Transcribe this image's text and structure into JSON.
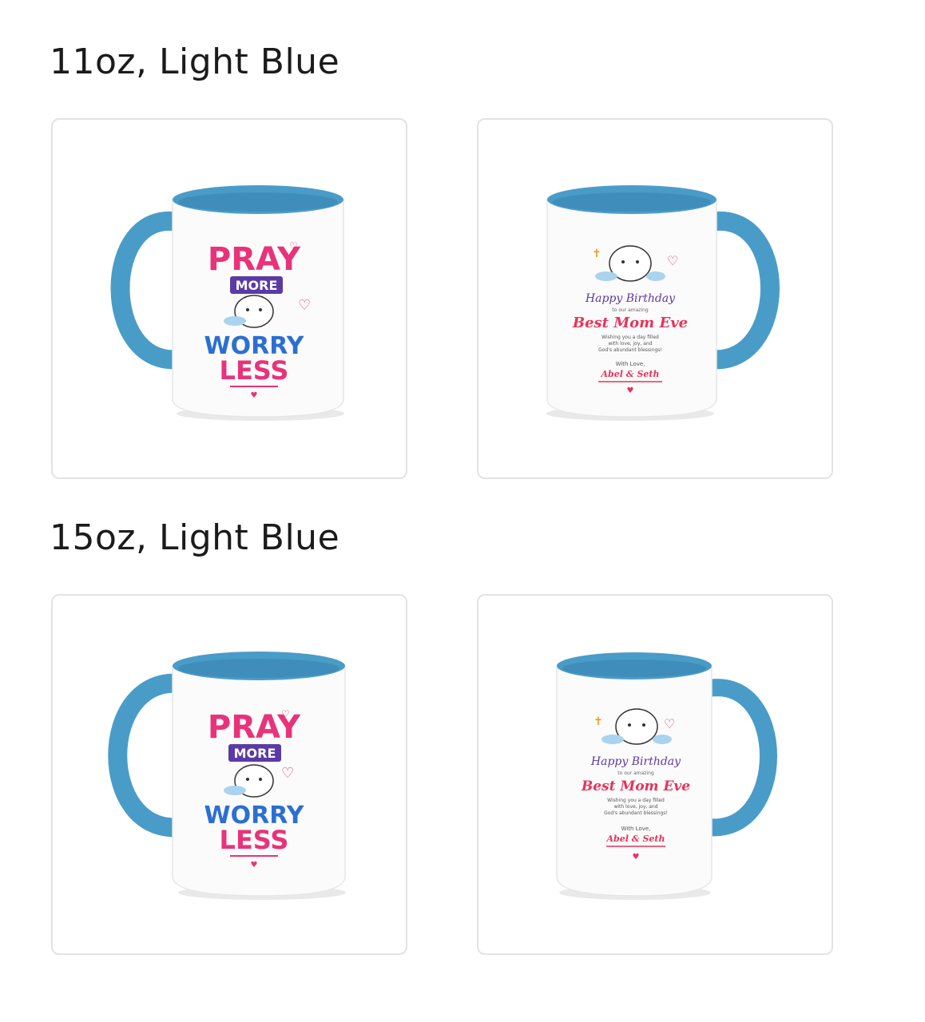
{
  "sections": [
    {
      "title": "11oz, Light Blue",
      "size": "11oz",
      "color_name": "Light Blue",
      "images": [
        {
          "view": "front",
          "design": "pray-more-worry-less"
        },
        {
          "view": "back",
          "design": "happy-birthday"
        }
      ]
    },
    {
      "title": "15oz, Light Blue",
      "size": "15oz",
      "color_name": "Light Blue",
      "images": [
        {
          "view": "front",
          "design": "pray-more-worry-less"
        },
        {
          "view": "back",
          "design": "happy-birthday"
        }
      ]
    }
  ],
  "design_front": {
    "line1": "PRAY",
    "line2": "MORE",
    "line3": "WORRY",
    "line4": "LESS"
  },
  "design_back": {
    "greeting": "Happy Birthday",
    "subline": "to our amazing",
    "headline": "Best Mom Eve",
    "wish_line1": "Wishing you a day filled",
    "wish_line2": "with love, joy, and",
    "wish_line3": "God's abundant blessings!",
    "signoff": "With Love,",
    "names": "Abel & Seth"
  },
  "colors": {
    "mug_accent": "#4a9cc8",
    "mug_body": "#ffffff",
    "card_border": "#e3e3e3",
    "pray_pink": "#e8337a",
    "pray_orange": "#f39a1f",
    "purple": "#5b3aa6",
    "blue_text": "#2c6fd1",
    "pink_script": "#e8335a"
  }
}
